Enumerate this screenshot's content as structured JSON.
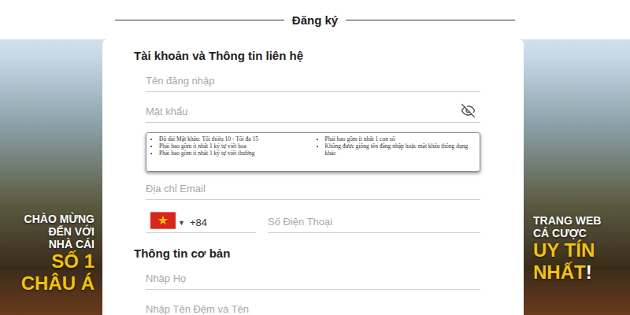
{
  "page": {
    "title": "Đăng ký"
  },
  "banners": {
    "left": [
      {
        "kind": "small",
        "segments": [
          {
            "text": "CHÀO MỪNG",
            "color": "#ffffff"
          }
        ]
      },
      {
        "kind": "small",
        "segments": [
          {
            "text": "ĐẾN VỚI",
            "color": "#ffffff"
          }
        ]
      },
      {
        "kind": "small",
        "segments": [
          {
            "text": "NHÀ CÁI",
            "color": "#ffffff"
          }
        ]
      },
      {
        "kind": "big",
        "segments": [
          {
            "text": "SỐ 1",
            "color": "#f5c400"
          }
        ]
      },
      {
        "kind": "big",
        "segments": [
          {
            "text": "CHÂU Á",
            "color": "#f5c400"
          }
        ]
      }
    ],
    "right": [
      {
        "kind": "small",
        "segments": [
          {
            "text": "TRANG WEB",
            "color": "#ffffff"
          }
        ]
      },
      {
        "kind": "small",
        "segments": [
          {
            "text": "CÁ CƯỢC",
            "color": "#ffffff"
          }
        ]
      },
      {
        "kind": "big",
        "segments": [
          {
            "text": "UY TÍN",
            "color": "#f5c400"
          }
        ]
      },
      {
        "kind": "big",
        "segments": [
          {
            "text": "NHẤT",
            "color": "#f5c400"
          },
          {
            "text": "!",
            "color": "#ffffff"
          }
        ]
      }
    ]
  },
  "form": {
    "sections": [
      {
        "title": "Tài khoản và Thông tin liên hệ",
        "fields": [
          {
            "kind": "text",
            "placeholder": "Tên đăng nhập"
          },
          {
            "kind": "password",
            "placeholder": "Mật khẩu",
            "visible": false
          },
          {
            "kind": "hint",
            "left": [
              "Độ dài Mật khẩu: Tối thiểu 10 - Tối đa 15",
              "Phải bao gồm ít nhất 1 ký tự viết hoa",
              "Phải bao gồm ít nhất 1 ký tự viết thường"
            ],
            "right": [
              "Phải bao gồm ít nhất 1 con số",
              "Không được giống tên đăng nhập hoặc mật khẩu thông dụng khác"
            ]
          },
          {
            "kind": "text",
            "placeholder": "Địa chỉ Email"
          },
          {
            "kind": "phone",
            "arrow": "▼",
            "code": "+84",
            "placeholder": "Số Điện Thoại"
          }
        ]
      },
      {
        "title": "Thông tin cơ bản",
        "fields": [
          {
            "kind": "text",
            "placeholder": "Nhập Họ"
          },
          {
            "kind": "text",
            "placeholder": "Nhập Tên Đệm và Tên"
          }
        ]
      }
    ]
  }
}
